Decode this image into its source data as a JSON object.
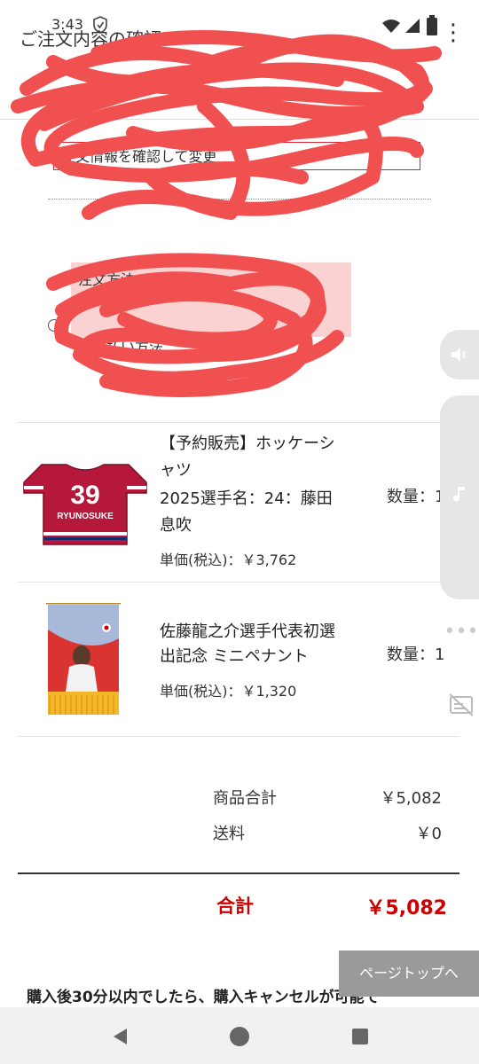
{
  "status": {
    "time": "3:43"
  },
  "top_bar": {
    "title": "ご注文内容の確認"
  },
  "notice_button": "注文情報を確認して変更",
  "method": {
    "label": "注文方法",
    "option": "各支払い方法"
  },
  "items": [
    {
      "name_line1": "【予約販売】ホッケーシ",
      "name_line2": "ャツ",
      "name_line3": "2025選手名：24：藤田",
      "name_line4": "息吹",
      "price": "単価(税込)：￥3,762",
      "qty": "数量：1",
      "jersey_number": "39",
      "jersey_name": "RYUNOSUKE"
    },
    {
      "name_line1": "佐藤龍之介選手代表初選",
      "name_line2": "出記念 ミニペナント",
      "price": "単価(税込)：￥1,320",
      "qty": "数量：1"
    }
  ],
  "totals": {
    "subtotal_label": "商品合計",
    "subtotal_value": "￥5,082",
    "shipping_label": "送料",
    "shipping_value": "￥0",
    "total_label": "合計",
    "total_value": "￥5,082"
  },
  "page_top": "ページトップへ",
  "cancel_note": "購入後30分以内でしたら、購入キャンセルが可能で",
  "colors": {
    "accent": "#cc0000",
    "scribble": "#f05050",
    "jersey": "#b5183a"
  },
  "icons": [
    "shield-icon",
    "wifi-icon",
    "signal-icon",
    "battery-icon",
    "menu-icon",
    "volume-icon",
    "music-icon",
    "more-icon",
    "caption-off-icon",
    "back-icon",
    "home-icon",
    "recents-icon"
  ]
}
